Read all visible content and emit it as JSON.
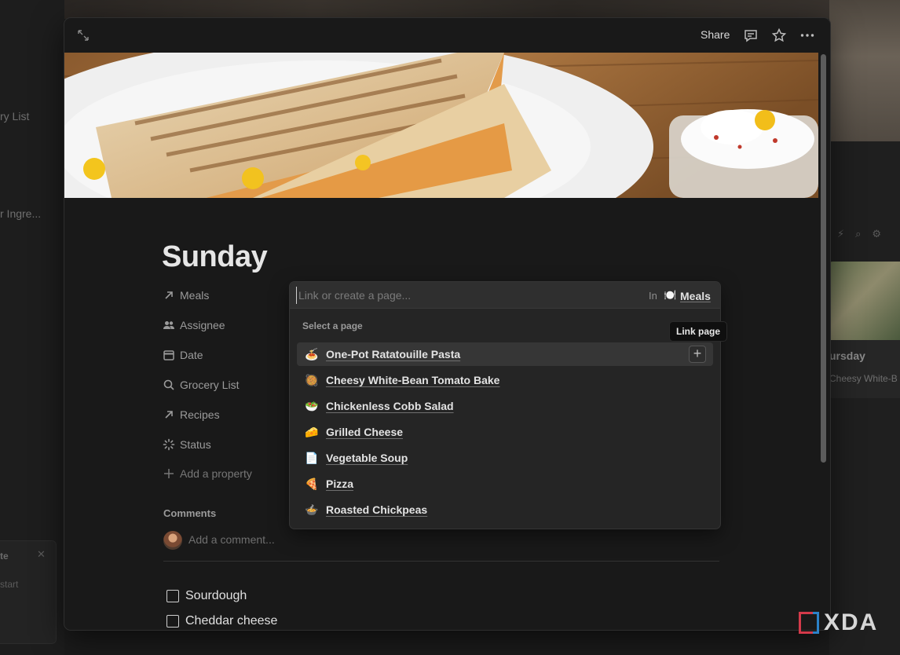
{
  "background": {
    "left_texts": [
      "ry List",
      "r Ingre..."
    ],
    "toast": {
      "title": "te",
      "body": "start"
    },
    "right_card": {
      "title": "ursday",
      "subtitle": "Cheesy White-B"
    }
  },
  "modal": {
    "share_label": "Share",
    "page": {
      "title": "Sunday",
      "properties": [
        {
          "icon": "arrow-up-right-icon",
          "label": "Meals"
        },
        {
          "icon": "people-icon",
          "label": "Assignee"
        },
        {
          "icon": "calendar-icon",
          "label": "Date"
        },
        {
          "icon": "search-icon",
          "label": "Grocery List"
        },
        {
          "icon": "arrow-up-right-icon",
          "label": "Recipes"
        },
        {
          "icon": "status-spinner-icon",
          "label": "Status"
        }
      ],
      "add_property_label": "Add a property",
      "comments_label": "Comments",
      "comment_placeholder": "Add a comment...",
      "todos": [
        {
          "label": "Sourdough",
          "checked": false
        },
        {
          "label": "Cheddar cheese",
          "checked": false
        }
      ]
    },
    "link_dropdown": {
      "placeholder": "Link or create a page...",
      "in_label": "In",
      "database_icon": "🍽️",
      "database_name": "Meals",
      "section_label": "Select a page",
      "items": [
        {
          "emoji": "🍝",
          "label": "One-Pot Ratatouille Pasta"
        },
        {
          "emoji": "🥘",
          "label": "Cheesy White-Bean Tomato Bake"
        },
        {
          "emoji": "🥗",
          "label": "Chickenless Cobb Salad"
        },
        {
          "emoji": "🧀",
          "label": "Grilled Cheese"
        },
        {
          "emoji": "📄",
          "label": "Vegetable Soup"
        },
        {
          "emoji": "🍕",
          "label": "Pizza"
        },
        {
          "emoji": "🍲",
          "label": "Roasted Chickpeas"
        }
      ],
      "tooltip": "Link page"
    }
  },
  "watermark": "XDA"
}
